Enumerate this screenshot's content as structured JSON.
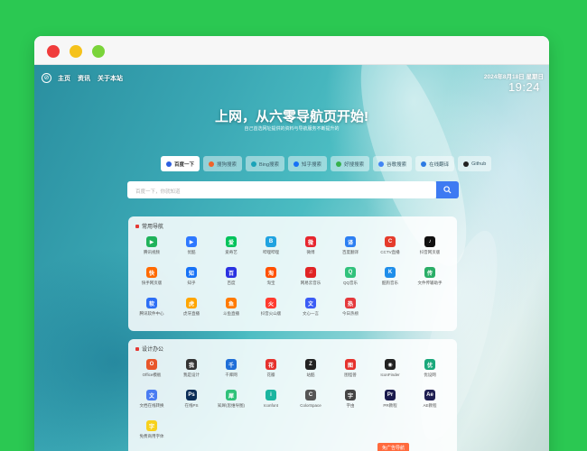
{
  "browser": {
    "close": "close",
    "minimize": "minimize",
    "maximize": "maximize"
  },
  "nav": {
    "logo_glyph": "⊘",
    "links": [
      "主页",
      "资讯",
      "关于本站"
    ]
  },
  "clock": {
    "date": "2024年8月18日 星期日",
    "time": "19:24"
  },
  "hero": {
    "title": "上网，从六零导航页开始!",
    "subtitle": "自己首选网址提供的资料与导航服务不断提升的"
  },
  "engines": [
    {
      "label": "百度一下",
      "color": "#2d5fe0",
      "active": true
    },
    {
      "label": "搜狗搜索",
      "color": "#f0632a",
      "active": false
    },
    {
      "label": "Bing搜索",
      "color": "#1aa3b8",
      "active": false
    },
    {
      "label": "知乎搜索",
      "color": "#1772f6",
      "active": false
    },
    {
      "label": "好搜搜索",
      "color": "#36b14c",
      "active": false
    },
    {
      "label": "谷歌搜索",
      "color": "#4285f4",
      "active": false
    },
    {
      "label": "在线翻译",
      "color": "#2e7be3",
      "active": false
    },
    {
      "label": "Github",
      "color": "#222222",
      "active": false
    }
  ],
  "search": {
    "placeholder": "百度一下，你就知道"
  },
  "panels": [
    {
      "title": "常用导航",
      "sites": [
        {
          "label": "腾讯视频",
          "color": "#1fb25a",
          "glyph": "▶"
        },
        {
          "label": "优酷",
          "color": "#2e78ff",
          "glyph": "▶"
        },
        {
          "label": "爱奇艺",
          "color": "#00c35b",
          "glyph": "爱"
        },
        {
          "label": "哔哩哔哩",
          "color": "#20a3e0",
          "glyph": "B"
        },
        {
          "label": "微博",
          "color": "#e6262e",
          "glyph": "微"
        },
        {
          "label": "百度翻译",
          "color": "#2c7ff2",
          "glyph": "译"
        },
        {
          "label": "CCTV直播",
          "color": "#e53c2c",
          "glyph": "C"
        },
        {
          "label": "抖音网页版",
          "color": "#111111",
          "glyph": "♪"
        },
        {
          "label": "快手网页版",
          "color": "#ff6a00",
          "glyph": "快"
        },
        {
          "label": "知乎",
          "color": "#1772f6",
          "glyph": "知"
        },
        {
          "label": "百度",
          "color": "#2932e1",
          "glyph": "百"
        },
        {
          "label": "淘宝",
          "color": "#ff5000",
          "glyph": "淘"
        },
        {
          "label": "网易云音乐",
          "color": "#e02424",
          "glyph": "♫"
        },
        {
          "label": "QQ音乐",
          "color": "#31c27c",
          "glyph": "Q"
        },
        {
          "label": "酷狗音乐",
          "color": "#1f8eea",
          "glyph": "K"
        },
        {
          "label": "文件传输助手",
          "color": "#2aae67",
          "glyph": "传"
        },
        {
          "label": "腾讯软件中心",
          "color": "#2d6ff5",
          "glyph": "软"
        },
        {
          "label": "虎牙直播",
          "color": "#ffa500",
          "glyph": "虎"
        },
        {
          "label": "斗鱼直播",
          "color": "#ff7a00",
          "glyph": "鱼"
        },
        {
          "label": "抖音火山版",
          "color": "#ff3b2f",
          "glyph": "火"
        },
        {
          "label": "文心一言",
          "color": "#3b5cf5",
          "glyph": "文"
        },
        {
          "label": "今日热榜",
          "color": "#e4393c",
          "glyph": "热"
        }
      ]
    },
    {
      "title": "设计办公",
      "sites": [
        {
          "label": "Office模板",
          "color": "#e8562a",
          "glyph": "O"
        },
        {
          "label": "我是设计",
          "color": "#333333",
          "glyph": "我"
        },
        {
          "label": "千库网",
          "color": "#1f6fd8",
          "glyph": "千"
        },
        {
          "label": "花瓣",
          "color": "#e5322d",
          "glyph": "花"
        },
        {
          "label": "站酷",
          "color": "#222222",
          "glyph": "Z"
        },
        {
          "label": "图怪兽",
          "color": "#e5322d",
          "glyph": "图"
        },
        {
          "label": "IconFinder",
          "color": "#222222",
          "glyph": "◉"
        },
        {
          "label": "优设网",
          "color": "#1aa87b",
          "glyph": "优"
        },
        {
          "label": "文档在线转换",
          "color": "#4a7cf2",
          "glyph": "文"
        },
        {
          "label": "在线PS",
          "color": "#0b2d57",
          "glyph": "Ps"
        },
        {
          "label": "知犀(思维导图)",
          "color": "#30c27a",
          "glyph": "犀"
        },
        {
          "label": "Iconfont",
          "color": "#1bb5a0",
          "glyph": "i"
        },
        {
          "label": "ColorSpace",
          "color": "#555555",
          "glyph": "C"
        },
        {
          "label": "字由",
          "color": "#444444",
          "glyph": "字"
        },
        {
          "label": "PR教程",
          "color": "#1a1a4d",
          "glyph": "Pr"
        },
        {
          "label": "AE教程",
          "color": "#1f1f52",
          "glyph": "Ae"
        },
        {
          "label": "免费商用字体",
          "color": "#f7d11c",
          "glyph": "字"
        }
      ]
    }
  ],
  "floating_button": {
    "label": "免广告导航"
  }
}
